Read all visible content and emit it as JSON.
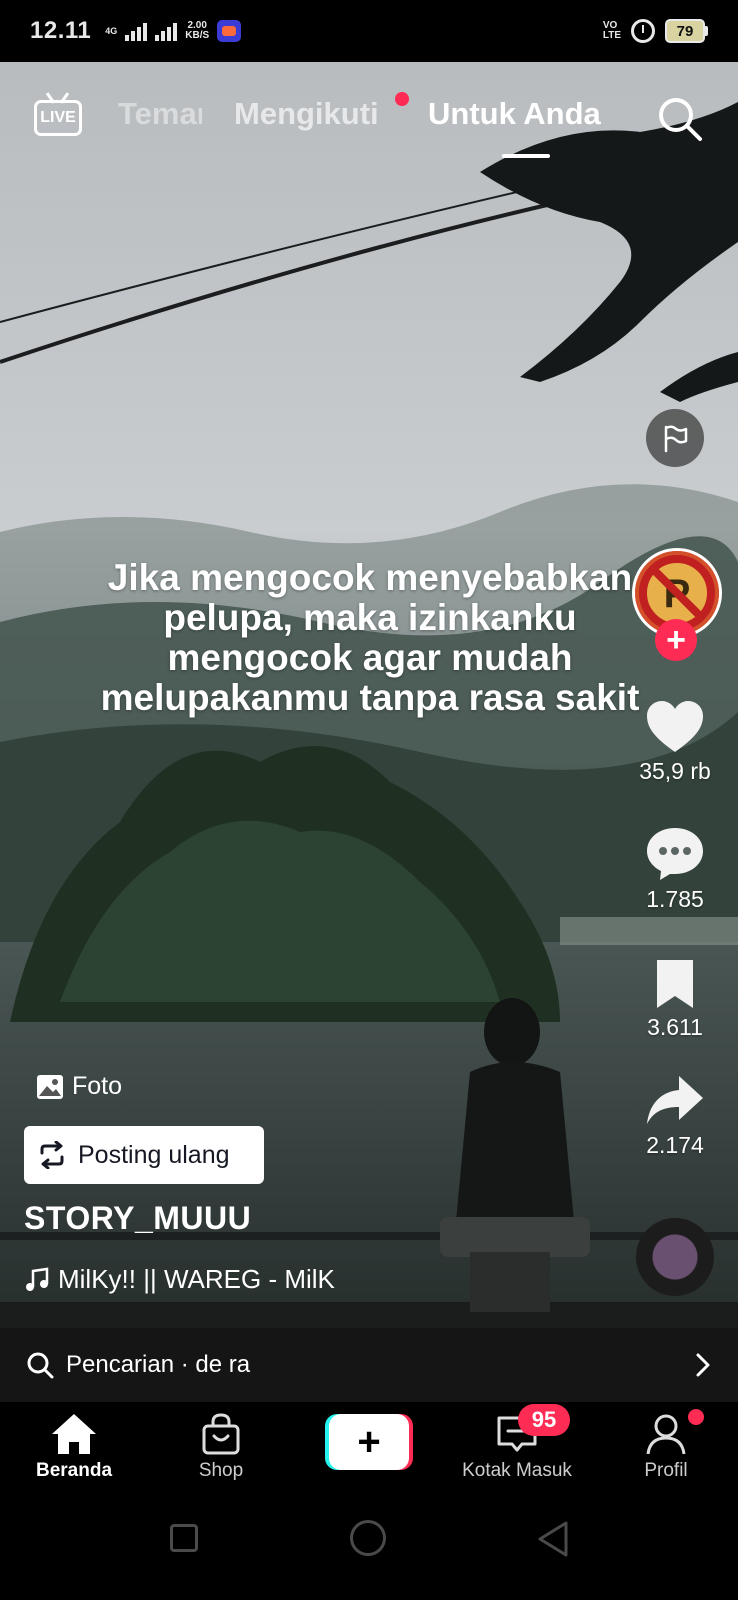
{
  "status_bar": {
    "time": "12.11",
    "network_type": "4G",
    "speed_value": "2.00",
    "speed_unit": "KB/S",
    "volte_top": "VO",
    "volte_bottom": "LTE",
    "battery_level": "79"
  },
  "top_tabs": {
    "live_label": "LIVE",
    "friends_tab": "Teman",
    "following_tab": "Mengikuti",
    "for_you_tab": "Untuk Anda",
    "active_tab": "Untuk Anda",
    "following_has_new": true
  },
  "post": {
    "overlay_text": "Jika mengocok menyebabkan pelupa, maka izinkanku mengocok agar mudah melupakanmu tanpa rasa sakit",
    "type_label": "Foto",
    "repost_label": "Posting ulang",
    "username": "STORY_MUUU",
    "music": "MilKy!! || WAREG - MilK"
  },
  "actions": {
    "likes": "35,9 rb",
    "comments": "1.785",
    "saves": "3.611",
    "shares": "2.174"
  },
  "search_suggestion": {
    "text": "Pencarian · de ra"
  },
  "bottom_nav": {
    "home": "Beranda",
    "shop": "Shop",
    "inbox": "Kotak Masuk",
    "inbox_badge": "95",
    "profile": "Profil"
  },
  "colors": {
    "accent": "#fe2c55",
    "cyan": "#25f4ee",
    "background": "#000000"
  }
}
